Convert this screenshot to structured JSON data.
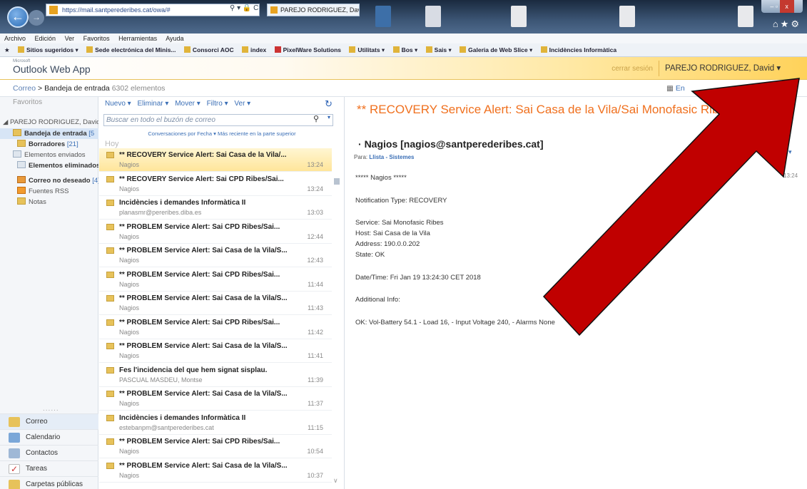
{
  "browser": {
    "url": "https://mail.santperederibes.cat/owa/#",
    "tab_title": "PAREJO RODRIGUEZ, David ...",
    "menu": [
      "Archivo",
      "Edición",
      "Ver",
      "Favoritos",
      "Herramientas",
      "Ayuda"
    ],
    "favorites": [
      "Sitios sugeridos ▾",
      "Sede electrónica del Minis...",
      "Consorci AOC",
      "index",
      "PixelWare Solutions",
      "Utilitats ▾",
      "Bos ▾",
      "Sais ▾",
      "Galeria de Web Slice ▾",
      "Incidències Informàtica"
    ]
  },
  "owa": {
    "app_name": "Outlook Web App",
    "ms_label": "Microsoft",
    "signout": "cerrar sesión",
    "user": "PAREJO RODRIGUEZ, David ▾"
  },
  "breadcrumb": {
    "root": "Correo",
    "sep": ">",
    "folder": "Bandeja de entrada",
    "count": "6302 elementos",
    "right": "En"
  },
  "nav": {
    "favorites_label": "Favoritos",
    "account": "PAREJO RODRIGUEZ, Davic",
    "folders": [
      {
        "label": "Bandeja de entrada",
        "count": "[5",
        "bold": true,
        "selected": true
      },
      {
        "label": "Borradores",
        "count": "[21]",
        "bold": true
      },
      {
        "label": "Elementos enviados",
        "count": "",
        "bold": false
      },
      {
        "label": "Elementos eliminados",
        "count": "",
        "bold": true
      },
      {
        "label": "Correo no deseado",
        "count": "[4]",
        "bold": true
      },
      {
        "label": "Fuentes RSS",
        "count": "",
        "bold": false
      },
      {
        "label": "Notas",
        "count": "",
        "bold": false
      }
    ],
    "dots": "......",
    "modules": [
      "Correo",
      "Calendario",
      "Contactos",
      "Tareas",
      "Carpetas públicas"
    ]
  },
  "list": {
    "toolbar": [
      "Nuevo ▾",
      "Eliminar ▾",
      "Mover ▾",
      "Filtro ▾",
      "Ver ▾"
    ],
    "search_placeholder": "Buscar en todo el buzón de correo",
    "conversations": "Conversaciones por Fecha ▾   Más reciente en la parte superior",
    "group": "Hoy",
    "messages": [
      {
        "subject": "** RECOVERY Service Alert: Sai Casa de la Vila/...",
        "from": "Nagios",
        "time": "13:24",
        "selected": true
      },
      {
        "subject": "** RECOVERY Service Alert: Sai CPD Ribes/Sai...",
        "from": "Nagios",
        "time": "13:24"
      },
      {
        "subject": "Incidències i demandes Informàtica II",
        "from": "planasmr@pereribes.diba.es",
        "time": "13:03"
      },
      {
        "subject": "** PROBLEM Service Alert: Sai CPD Ribes/Sai...",
        "from": "Nagios",
        "time": "12:44"
      },
      {
        "subject": "** PROBLEM Service Alert: Sai Casa de la Vila/S...",
        "from": "Nagios",
        "time": "12:43"
      },
      {
        "subject": "** PROBLEM Service Alert: Sai CPD Ribes/Sai...",
        "from": "Nagios",
        "time": "11:44"
      },
      {
        "subject": "** PROBLEM Service Alert: Sai Casa de la Vila/S...",
        "from": "Nagios",
        "time": "11:43"
      },
      {
        "subject": "** PROBLEM Service Alert: Sai CPD Ribes/Sai...",
        "from": "Nagios",
        "time": "11:42"
      },
      {
        "subject": "** PROBLEM Service Alert: Sai Casa de la Vila/S...",
        "from": "Nagios",
        "time": "11:41"
      },
      {
        "subject": "Fes l'incidencia del que hem signat sisplau.",
        "from": "PASCUAL MASDEU, Montse",
        "time": "11:39"
      },
      {
        "subject": "** PROBLEM Service Alert: Sai Casa de la Vila/S...",
        "from": "Nagios",
        "time": "11:37"
      },
      {
        "subject": "Incidències i demandes Informàtica II",
        "from": "estebanpm@santperederibes.cat",
        "time": "11:15"
      },
      {
        "subject": "** PROBLEM Service Alert: Sai CPD Ribes/Sai...",
        "from": "Nagios",
        "time": "10:54"
      },
      {
        "subject": "** PROBLEM Service Alert: Sai Casa de la Vila/S...",
        "from": "Nagios",
        "time": "10:37"
      }
    ]
  },
  "reading": {
    "title": "** RECOVERY Service Alert: Sai Casa de la Vila/Sai Monofasic Ribes",
    "from": "Nagios [nagios@santperederibes.cat]",
    "to_label": "Para:",
    "to": "Llista - Sistemes",
    "actions": "nes ▾",
    "time": "13:24",
    "body": [
      "***** Nagios *****",
      "Notification Type: RECOVERY",
      "Service: Sai Monofasic Ribes",
      "Host: Sai Casa de la Vila",
      "Address: 190.0.0.202",
      "State: OK",
      "Date/Time: Fri Jan 19 13:24:30 CET 2018",
      "Additional Info:",
      "OK: Vol-Battery 54.1 - Load 16, - Input Voltage 240, - Alarms None"
    ]
  },
  "colors": {
    "accent": "#3b6fb6",
    "title_orange": "#f0701e",
    "arrow_red": "#c00000"
  }
}
